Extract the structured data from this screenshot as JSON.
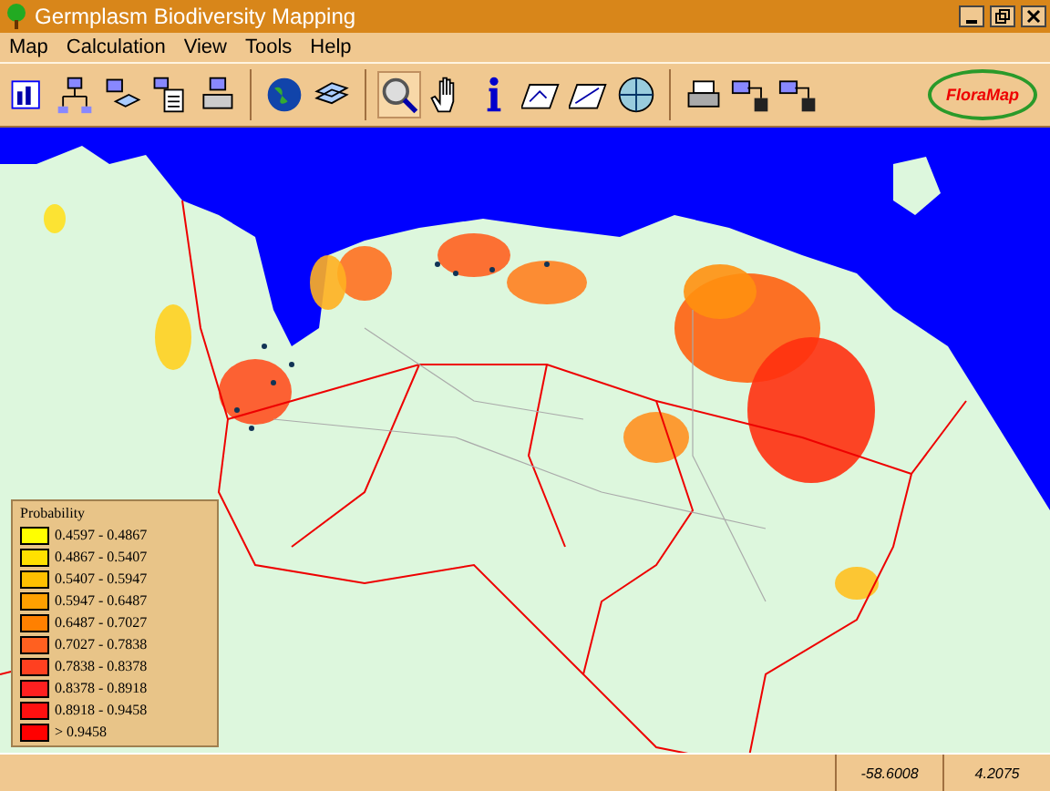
{
  "window": {
    "title": "Germplasm Biodiversity Mapping"
  },
  "menu": [
    {
      "label": "Map"
    },
    {
      "label": "Calculation"
    },
    {
      "label": "View"
    },
    {
      "label": "Tools"
    },
    {
      "label": "Help"
    }
  ],
  "toolbar": {
    "logo": "FloraMap"
  },
  "legend": {
    "title": "Probability",
    "items": [
      {
        "label": "0.4597 - 0.4867",
        "color": "#ffff00"
      },
      {
        "label": "0.4867 - 0.5407",
        "color": "#ffe000"
      },
      {
        "label": "0.5407 - 0.5947",
        "color": "#ffc000"
      },
      {
        "label": "0.5947 - 0.6487",
        "color": "#ffa000"
      },
      {
        "label": "0.6487 - 0.7027",
        "color": "#ff8000"
      },
      {
        "label": "0.7027 - 0.7838",
        "color": "#ff6020"
      },
      {
        "label": "0.7838 - 0.8378",
        "color": "#ff4020"
      },
      {
        "label": "0.8378 - 0.8918",
        "color": "#ff2020"
      },
      {
        "label": "0.8918 - 0.9458",
        "color": "#ff1010"
      },
      {
        "label": "> 0.9458",
        "color": "#ff0000"
      }
    ]
  },
  "status_bar": {
    "longitude": "-58.6008",
    "latitude": "4.2075"
  }
}
